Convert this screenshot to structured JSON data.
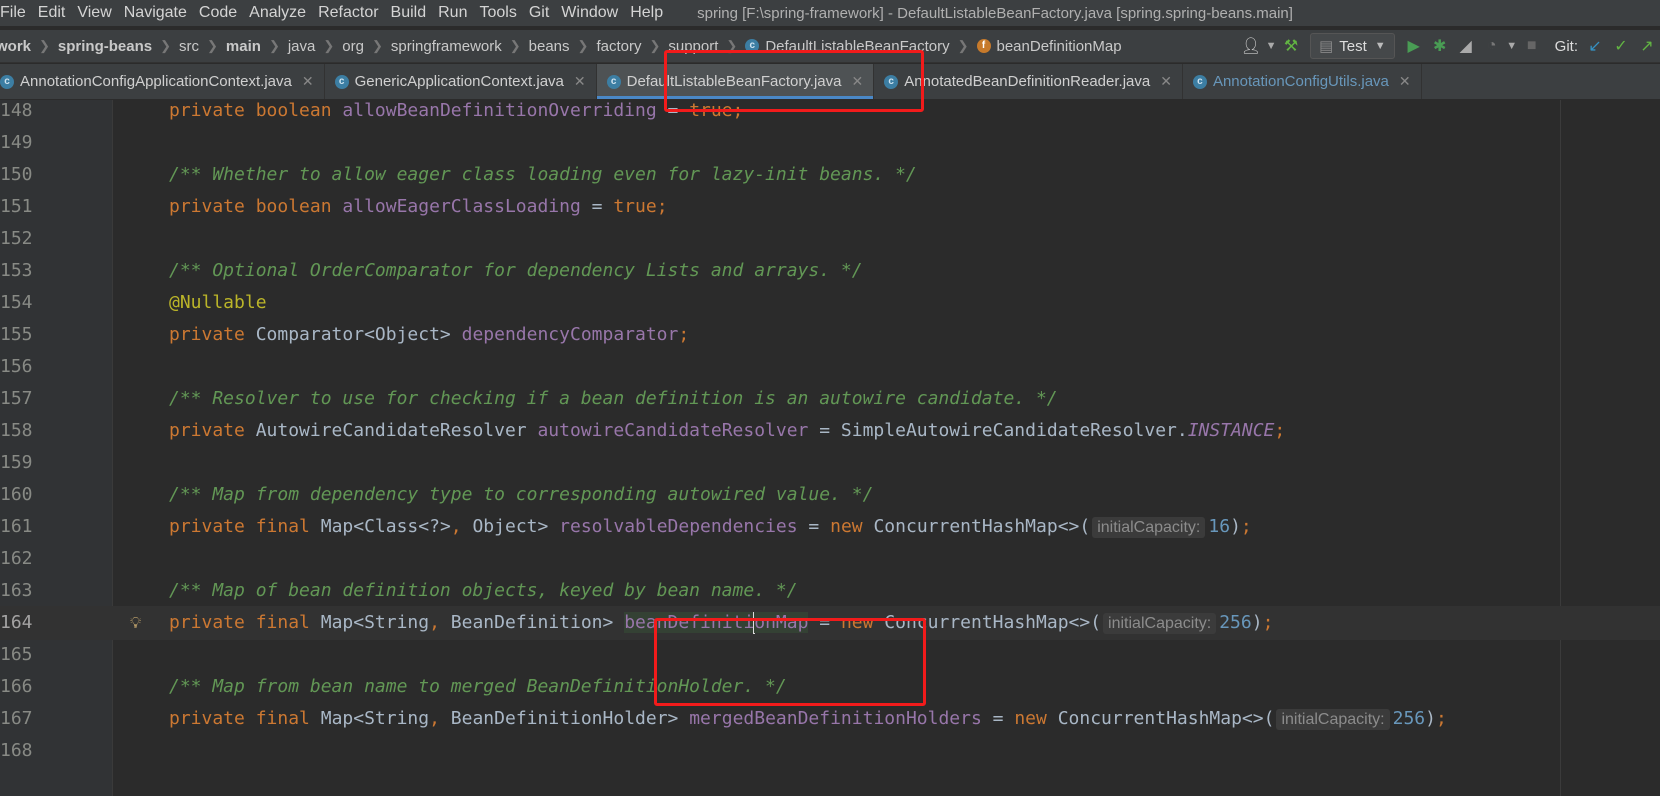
{
  "menubar": {
    "items": [
      "File",
      "Edit",
      "View",
      "Navigate",
      "Code",
      "Analyze",
      "Refactor",
      "Build",
      "Run",
      "Tools",
      "Git",
      "Window",
      "Help"
    ],
    "window_title": "spring [F:\\spring-framework] - DefaultListableBeanFactory.java [spring.spring-beans.main]"
  },
  "breadcrumbs": [
    {
      "label": "work",
      "bold": true
    },
    {
      "label": "spring-beans",
      "bold": true
    },
    {
      "label": "src"
    },
    {
      "label": "main",
      "bold": true
    },
    {
      "label": "java"
    },
    {
      "label": "org"
    },
    {
      "label": "springframework"
    },
    {
      "label": "beans"
    },
    {
      "label": "factory"
    },
    {
      "label": "support"
    },
    {
      "label": "DefaultListableBeanFactory",
      "icon": "class-icon"
    },
    {
      "label": "beanDefinitionMap",
      "icon": "field-icon"
    }
  ],
  "toolbar": {
    "run_config": "Test",
    "git_label": "Git:",
    "colors": {
      "run": "#499c54",
      "debug": "#499c54",
      "update": "#3592c4",
      "commit": "#62b543"
    }
  },
  "tabs": [
    {
      "label": "AnnotationConfigApplicationContext.java",
      "active": false,
      "modified": false
    },
    {
      "label": "GenericApplicationContext.java",
      "active": false,
      "modified": false
    },
    {
      "label": "DefaultListableBeanFactory.java",
      "active": true,
      "modified": false
    },
    {
      "label": "AnnotatedBeanDefinitionReader.java",
      "active": false,
      "modified": false
    },
    {
      "label": "AnnotationConfigUtils.java",
      "active": false,
      "modified": true
    }
  ],
  "editor": {
    "lines": [
      {
        "n": "148",
        "tokens": [
          [
            "kw",
            "private "
          ],
          [
            "kw",
            "boolean "
          ],
          [
            "fd",
            "allowBeanDefinitionOverriding"
          ],
          [
            "ty",
            " = "
          ],
          [
            "kw",
            "true;"
          ]
        ]
      },
      {
        "n": "149",
        "tokens": []
      },
      {
        "n": "150",
        "tokens": [
          [
            "cm",
            "/** Whether to allow eager class loading even for lazy-init beans. */"
          ]
        ]
      },
      {
        "n": "151",
        "tokens": [
          [
            "kw",
            "private "
          ],
          [
            "kw",
            "boolean "
          ],
          [
            "fd",
            "allowEagerClassLoading"
          ],
          [
            "ty",
            " = "
          ],
          [
            "kw",
            "true;"
          ]
        ]
      },
      {
        "n": "152",
        "tokens": []
      },
      {
        "n": "153",
        "tokens": [
          [
            "cm",
            "/** Optional OrderComparator for dependency Lists and arrays. */"
          ]
        ]
      },
      {
        "n": "154",
        "tokens": [
          [
            "an",
            "@Nullable"
          ]
        ]
      },
      {
        "n": "155",
        "tokens": [
          [
            "kw",
            "private "
          ],
          [
            "ty",
            "Comparator<Object> "
          ],
          [
            "fd",
            "dependencyComparator"
          ],
          [
            "kw",
            ";"
          ]
        ]
      },
      {
        "n": "156",
        "tokens": []
      },
      {
        "n": "157",
        "tokens": [
          [
            "cm",
            "/** Resolver to use for checking if a bean definition is an autowire candidate. */"
          ]
        ]
      },
      {
        "n": "158",
        "tokens": [
          [
            "kw",
            "private "
          ],
          [
            "ty",
            "AutowireCandidateResolver "
          ],
          [
            "fd",
            "autowireCandidateResolver"
          ],
          [
            "ty",
            " = SimpleAutowireCandidateResolver."
          ],
          [
            "st",
            "INSTANCE"
          ],
          [
            "kw",
            ";"
          ]
        ]
      },
      {
        "n": "159",
        "tokens": []
      },
      {
        "n": "160",
        "tokens": [
          [
            "cm",
            "/** Map from dependency type to corresponding autowired value. */"
          ]
        ]
      },
      {
        "n": "161",
        "tokens": [
          [
            "kw",
            "private "
          ],
          [
            "kw",
            "final "
          ],
          [
            "ty",
            "Map<Class<?>"
          ],
          [
            "kw",
            ", "
          ],
          [
            "ty",
            "Object> "
          ],
          [
            "fd",
            "resolvableDependencies"
          ],
          [
            "ty",
            " = "
          ],
          [
            "kw",
            "new "
          ],
          [
            "ty",
            "ConcurrentHashMap<>("
          ],
          [
            "hint",
            "initialCapacity:"
          ],
          [
            "nm",
            "16"
          ],
          [
            "ty",
            ")"
          ],
          [
            "kw",
            ";"
          ]
        ]
      },
      {
        "n": "162",
        "tokens": []
      },
      {
        "n": "163",
        "tokens": [
          [
            "cm",
            "/** Map of bean definition objects, keyed by bean name. */"
          ]
        ]
      },
      {
        "n": "164",
        "current": true,
        "bulb": true,
        "tokens": [
          [
            "kw",
            "private "
          ],
          [
            "kw",
            "final "
          ],
          [
            "ty",
            "Map<String"
          ],
          [
            "kw",
            ", "
          ],
          [
            "ty",
            "BeanDefinition> "
          ],
          [
            "fdhl",
            "beanDefiniti"
          ],
          [
            "caret",
            ""
          ],
          [
            "fdhl",
            "onMap"
          ],
          [
            "ty",
            " = "
          ],
          [
            "kw",
            "new "
          ],
          [
            "ty",
            "ConcurrentHashMap<>("
          ],
          [
            "hint",
            "initialCapacity:"
          ],
          [
            "nm",
            "256"
          ],
          [
            "ty",
            ")"
          ],
          [
            "kw",
            ";"
          ]
        ]
      },
      {
        "n": "165",
        "tokens": []
      },
      {
        "n": "166",
        "tokens": [
          [
            "cm",
            "/** Map from bean name to merged BeanDefinitionHolder. */"
          ]
        ]
      },
      {
        "n": "167",
        "tokens": [
          [
            "kw",
            "private "
          ],
          [
            "kw",
            "final "
          ],
          [
            "ty",
            "Map<String"
          ],
          [
            "kw",
            ", "
          ],
          [
            "ty",
            "BeanDefinitionHolder> "
          ],
          [
            "fd",
            "mergedBeanDefinitionHolders"
          ],
          [
            "ty",
            " = "
          ],
          [
            "kw",
            "new "
          ],
          [
            "ty",
            "ConcurrentHashMap<>("
          ],
          [
            "hint",
            "initialCapacity:"
          ],
          [
            "nm",
            "256"
          ],
          [
            "ty",
            ")"
          ],
          [
            "kw",
            ";"
          ]
        ]
      },
      {
        "n": "168",
        "tokens": []
      }
    ]
  },
  "annotation_color": "#f21b1b"
}
